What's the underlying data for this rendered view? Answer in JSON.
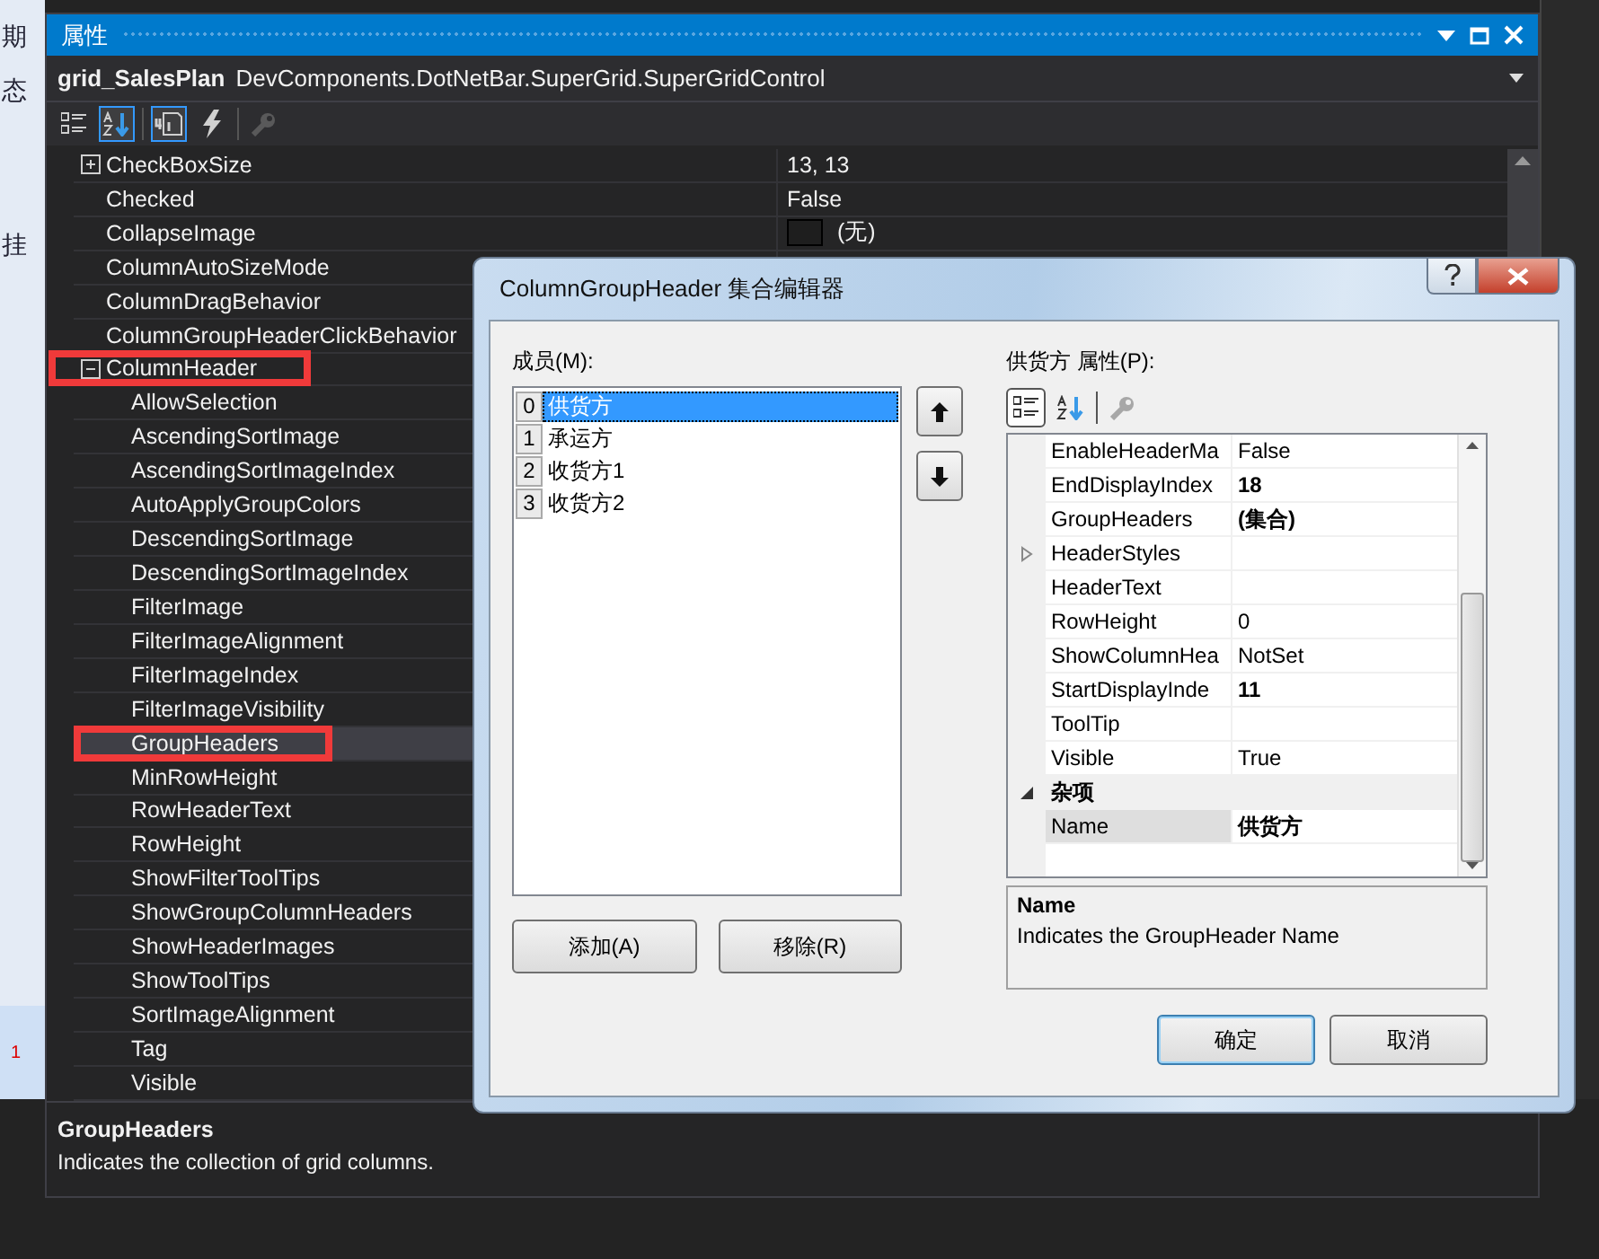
{
  "background_window": {
    "texts": [
      "期",
      "态",
      "挂"
    ],
    "row_number": "1"
  },
  "properties_window": {
    "title": "属性",
    "object_name": "grid_SalesPlan",
    "object_type": "DevComponents.DotNetBar.SuperGrid.SuperGridControl",
    "toolbar": [
      {
        "kind": "categorized",
        "selected": false,
        "disabled": false
      },
      {
        "kind": "alphabetical",
        "selected": true,
        "disabled": false
      },
      {
        "kind": "pages",
        "selected": true,
        "disabled": false
      },
      {
        "kind": "events",
        "selected": false,
        "disabled": false
      },
      {
        "kind": "wrench",
        "selected": false,
        "disabled": true
      }
    ],
    "rows": [
      {
        "name": "CheckBoxSize",
        "value": "13, 13",
        "expanded": false,
        "selected": false
      },
      {
        "name": "Checked",
        "value": "False",
        "selected": false
      },
      {
        "name": "CollapseImage",
        "value": "(无)",
        "kind": "image",
        "selected": false
      },
      {
        "name": "ColumnAutoSizeMode",
        "selected": false
      },
      {
        "name": "ColumnDragBehavior",
        "selected": false
      },
      {
        "name": "ColumnGroupHeaderClickBehavior",
        "selected": false
      },
      {
        "name": "ColumnHeader",
        "expanded": true,
        "selected": false,
        "highlighted": true,
        "children": [
          {
            "name": "AllowSelection",
            "selected": false
          },
          {
            "name": "AscendingSortImage",
            "selected": false
          },
          {
            "name": "AscendingSortImageIndex",
            "selected": false
          },
          {
            "name": "AutoApplyGroupColors",
            "selected": false
          },
          {
            "name": "DescendingSortImage",
            "selected": false
          },
          {
            "name": "DescendingSortImageIndex",
            "selected": false
          },
          {
            "name": "FilterImage",
            "selected": false
          },
          {
            "name": "FilterImageAlignment",
            "selected": false
          },
          {
            "name": "FilterImageIndex",
            "selected": false
          },
          {
            "name": "FilterImageVisibility",
            "selected": false
          },
          {
            "name": "GroupHeaders",
            "selected": true,
            "highlighted": true
          },
          {
            "name": "MinRowHeight",
            "selected": false
          },
          {
            "name": "RowHeaderText",
            "selected": false
          },
          {
            "name": "RowHeight",
            "selected": false
          },
          {
            "name": "ShowFilterToolTips",
            "selected": false
          },
          {
            "name": "ShowGroupColumnHeaders",
            "selected": false
          },
          {
            "name": "ShowHeaderImages",
            "selected": false
          },
          {
            "name": "ShowToolTips",
            "selected": false
          },
          {
            "name": "SortImageAlignment",
            "selected": false
          },
          {
            "name": "Tag",
            "selected": false
          },
          {
            "name": "Visible",
            "selected": false
          }
        ]
      }
    ],
    "description": {
      "title": "GroupHeaders",
      "text": "Indicates the collection of grid columns."
    }
  },
  "dialog": {
    "title": "ColumnGroupHeader 集合编辑器",
    "members_label": "成员(M):",
    "members": [
      {
        "index": "0",
        "name": "供货方",
        "selected": true
      },
      {
        "index": "1",
        "name": "承运方",
        "selected": false
      },
      {
        "index": "2",
        "name": "收货方1",
        "selected": false
      },
      {
        "index": "3",
        "name": "收货方2",
        "selected": false
      }
    ],
    "add_button": "添加(A)",
    "remove_button": "移除(R)",
    "properties_label": "供货方 属性(P):",
    "toolbar": [
      {
        "kind": "categorized",
        "selected": true,
        "disabled": false
      },
      {
        "kind": "alphabetical",
        "selected": false,
        "disabled": false
      },
      {
        "kind": "wrench",
        "selected": false,
        "disabled": true
      }
    ],
    "rows": [
      {
        "kind": "property",
        "name": "EnableHeaderMa",
        "value": "False",
        "modified": false,
        "selected": false
      },
      {
        "kind": "property",
        "name": "EndDisplayIndex",
        "value": "18",
        "modified": true,
        "selected": false
      },
      {
        "kind": "property",
        "name": "GroupHeaders",
        "value": "(集合)",
        "modified": true,
        "selected": false
      },
      {
        "kind": "property",
        "name": "HeaderStyles",
        "expanded": false,
        "selected": false
      },
      {
        "kind": "property",
        "name": "HeaderText",
        "selected": false
      },
      {
        "kind": "property",
        "name": "RowHeight",
        "value": "0",
        "modified": false,
        "selected": false
      },
      {
        "kind": "property",
        "name": "ShowColumnHea",
        "value": "NotSet",
        "modified": false,
        "selected": false
      },
      {
        "kind": "property",
        "name": "StartDisplayInde",
        "value": "11",
        "modified": true,
        "selected": false
      },
      {
        "kind": "property",
        "name": "ToolTip",
        "selected": false
      },
      {
        "kind": "property",
        "name": "Visible",
        "value": "True",
        "modified": false,
        "selected": false
      },
      {
        "kind": "category",
        "name": "杂项",
        "expanded": true
      },
      {
        "kind": "property",
        "name": "Name",
        "value": "供货方",
        "modified": true,
        "selected": true
      }
    ],
    "description": {
      "title": "Name",
      "text": "Indicates the GroupHeader Name"
    },
    "ok_button": {
      "label": "确定",
      "default": true
    },
    "cancel_button": {
      "label": "取消",
      "default": false
    }
  }
}
